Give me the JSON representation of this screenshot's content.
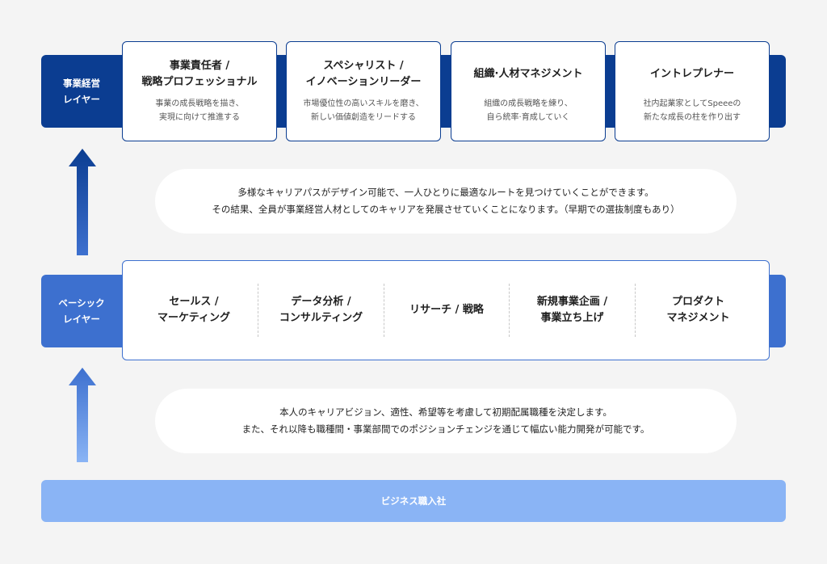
{
  "top_layer": {
    "label_line1": "事業経営",
    "label_line2": "レイヤー",
    "color": "#0b3d91",
    "roles": [
      {
        "title_line1": "事業責任者 /",
        "title_line2": "戦略プロフェッショナル",
        "desc_line1": "事業の成長戦略を描き、",
        "desc_line2": "実現に向けて推進する"
      },
      {
        "title_line1": "スペシャリスト /",
        "title_line2": "イノベーションリーダー",
        "desc_line1": "市場優位性の高いスキルを磨き、",
        "desc_line2": "新しい価値創造をリードする"
      },
      {
        "title_line1": "組織·人材マネジメント",
        "title_line2": "",
        "desc_line1": "組織の成長戦略を練り、",
        "desc_line2": "自ら統率·育成していく"
      },
      {
        "title_line1": "イントレプレナー",
        "title_line2": "",
        "desc_line1": "社内起業家としてSpeeeの",
        "desc_line2": "新たな成長の柱を作り出す"
      }
    ]
  },
  "upper_bubble": {
    "line1": "多様なキャリアパスがデザイン可能で、一人ひとりに最適なルートを見つけていくことができます。",
    "line2": "その結果、全員が事業経営人材としてのキャリアを発展させていくことになります。（早期での選抜制度もあり）"
  },
  "basic_layer": {
    "label_line1": "ベーシック",
    "label_line2": "レイヤー",
    "color": "#3d70cf",
    "items": [
      {
        "line1": "セールス /",
        "line2": "マーケティング"
      },
      {
        "line1": "データ分析 /",
        "line2": "コンサルティング"
      },
      {
        "line1": "リサーチ / 戦略",
        "line2": ""
      },
      {
        "line1": "新規事業企画 /",
        "line2": "事業立ち上げ"
      },
      {
        "line1": "プロダクト",
        "line2": "マネジメント"
      }
    ]
  },
  "lower_bubble": {
    "line1": "本人のキャリアビジョン、適性、希望等を考慮して初期配属職種を決定します。",
    "line2": "また、それ以降も職種間・事業部間でのポジションチェンジを通じて幅広い能力開発が可能です。"
  },
  "entry": {
    "label": "ビジネス職入社",
    "color": "#8ab4f5"
  }
}
